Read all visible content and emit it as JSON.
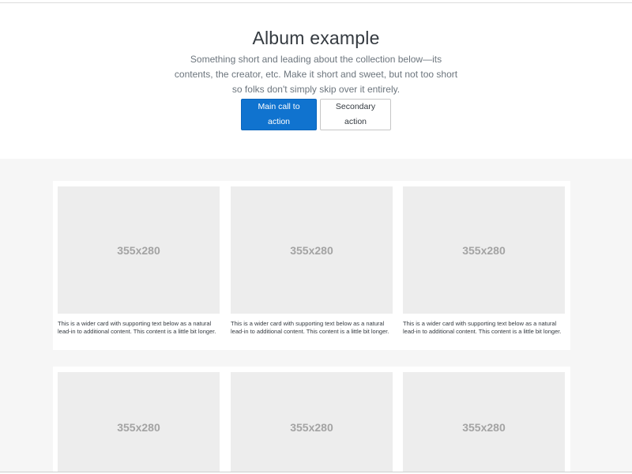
{
  "hero": {
    "heading": "Album example",
    "lead": "Something short and leading about the collection below—its contents, the creator, etc. Make it short and sweet, but not too short so folks don't simply skip over it entirely.",
    "primary_button": "Main call to action",
    "secondary_button": "Secondary action"
  },
  "colors": {
    "primary": "#1073cf",
    "album_background": "#f6f6f6",
    "thumbnail_background": "#ededed"
  },
  "cards": [
    {
      "thumbnail_label": "355x280",
      "text": "This is a wider card with supporting text below as a natural lead-in to additional content. This content is a little bit longer."
    },
    {
      "thumbnail_label": "355x280",
      "text": "This is a wider card with supporting text below as a natural lead-in to additional content. This content is a little bit longer."
    },
    {
      "thumbnail_label": "355x280",
      "text": "This is a wider card with supporting text below as a natural lead-in to additional content. This content is a little bit longer."
    },
    {
      "thumbnail_label": "355x280"
    },
    {
      "thumbnail_label": "355x280"
    },
    {
      "thumbnail_label": "355x280"
    }
  ]
}
